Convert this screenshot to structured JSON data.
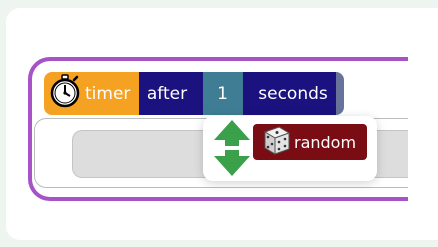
{
  "timer_block": {
    "timer_label": "timer",
    "after_label": "after",
    "duration_value": "1",
    "seconds_label": "seconds",
    "colors": {
      "timer": "#f5a121",
      "keyword": "#1b117f",
      "value_slot": "#3f7d94",
      "event_outline": "#a553c7"
    }
  },
  "suggestion_popup": {
    "random_label": "random",
    "icons": [
      "stopwatch-icon",
      "up-down-arrows-icon",
      "dice-icon"
    ],
    "colors": {
      "random_block": "#7a0c14",
      "arrows": "#3aa04a"
    }
  }
}
